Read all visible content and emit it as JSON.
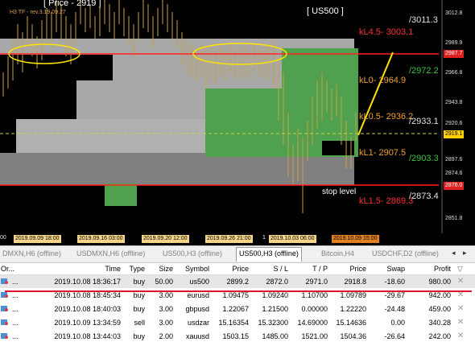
{
  "chart": {
    "title": "[ Price - 2919 ]",
    "subtitle": "H3 TF - rev.3.19.09.27",
    "symbol_label": "[ US500 ]",
    "levels": [
      {
        "label": "kL4.5- 3003.1",
        "color": "#ff3030"
      },
      {
        "label": "kL0- 2964.9",
        "color": "#f0a030"
      },
      {
        "label": "kL0.5- 2936.2",
        "color": "#f0a030"
      },
      {
        "label": "kL1- 2907.5",
        "color": "#f0a030"
      },
      {
        "label": "kL1.5- 2869.3",
        "color": "#ff3030"
      }
    ],
    "right_labels": [
      {
        "label": "/3011.3",
        "color": "#e0e0e0"
      },
      {
        "label": "/2972.2",
        "color": "#40c040"
      },
      {
        "label": "/2933.1",
        "color": "#e0e0e0"
      },
      {
        "label": "/2903.3",
        "color": "#40c040"
      },
      {
        "label": "/2873.4",
        "color": "#e0e0e0"
      }
    ],
    "stop_label": "stop level",
    "axis_ticks": [
      "3012.8",
      "2989.9",
      "2966.8",
      "2943.8",
      "2920.6",
      "2897.6",
      "2874.6",
      "2851.8"
    ],
    "price_tags": [
      {
        "label": "2987.7",
        "bg": "#e02020",
        "fg": "#ffffff"
      },
      {
        "label": "2919.1",
        "bg": "#ffd000",
        "fg": "#000000"
      },
      {
        "label": "2876.0",
        "bg": "#e02020",
        "fg": "#ffffff"
      }
    ],
    "date_labels": [
      "2019.09.09 18:00",
      "2019.09.16 03:00",
      "2019.09.20 12:00",
      "2019.09.26 21:00",
      "2019.10.03 06:00",
      "2019.10.09 15:00"
    ],
    "date_edge_left": "00",
    "date_marker": "1"
  },
  "tabs": [
    {
      "label": "DMXN,H6 (offline)",
      "active": false
    },
    {
      "label": "USDMXN,H6 (offline)",
      "active": false
    },
    {
      "label": "US500,H3 (offline)",
      "active": false
    },
    {
      "label": "US500,H3 (offline)",
      "active": true
    },
    {
      "label": "Bitcoin,H4",
      "active": false
    },
    {
      "label": "USDCHF,D2 (offline)",
      "active": false
    }
  ],
  "tab_arrows": {
    "left": "◂",
    "right": "▸"
  },
  "orders": {
    "columns": [
      "Or...",
      "Time",
      "Type",
      "Size",
      "Symbol",
      "Price",
      "S / L",
      "T / P",
      "Price",
      "Swap",
      "Profit"
    ],
    "sort_indicator": "▽",
    "rows": [
      {
        "order": "...",
        "time": "2019.10.08 18:36:17",
        "type": "buy",
        "size": "50.00",
        "symbol": "us500",
        "price": "2899.2",
        "sl": "2872.0",
        "tp": "2971.0",
        "cur_price": "2918.8",
        "swap": "-18.60",
        "profit": "980.00"
      },
      {
        "order": "...",
        "time": "2019.10.08 18:45:34",
        "type": "buy",
        "size": "3.00",
        "symbol": "eurusd",
        "price": "1.09475",
        "sl": "1.09240",
        "tp": "1.10700",
        "cur_price": "1.09789",
        "swap": "-29.67",
        "profit": "942.00"
      },
      {
        "order": "...",
        "time": "2019.10.08 18:40:03",
        "type": "buy",
        "size": "3.00",
        "symbol": "gbpusd",
        "price": "1.22067",
        "sl": "1.21500",
        "tp": "0.00000",
        "cur_price": "1.22220",
        "swap": "-24.48",
        "profit": "459.00"
      },
      {
        "order": "...",
        "time": "2019.10.09 13:34:59",
        "type": "sell",
        "size": "3.00",
        "symbol": "usdzar",
        "price": "15.16354",
        "sl": "15.32300",
        "tp": "14.69000",
        "cur_price": "15.14636",
        "swap": "0.00",
        "profit": "340.28"
      },
      {
        "order": "...",
        "time": "2019.10.08 13:44:03",
        "type": "buy",
        "size": "2.00",
        "symbol": "xauusd",
        "price": "1503.15",
        "sl": "1485.00",
        "tp": "1521.00",
        "cur_price": "1504.36",
        "swap": "-26.64",
        "profit": "242.00"
      }
    ],
    "close_glyph": "✕"
  }
}
